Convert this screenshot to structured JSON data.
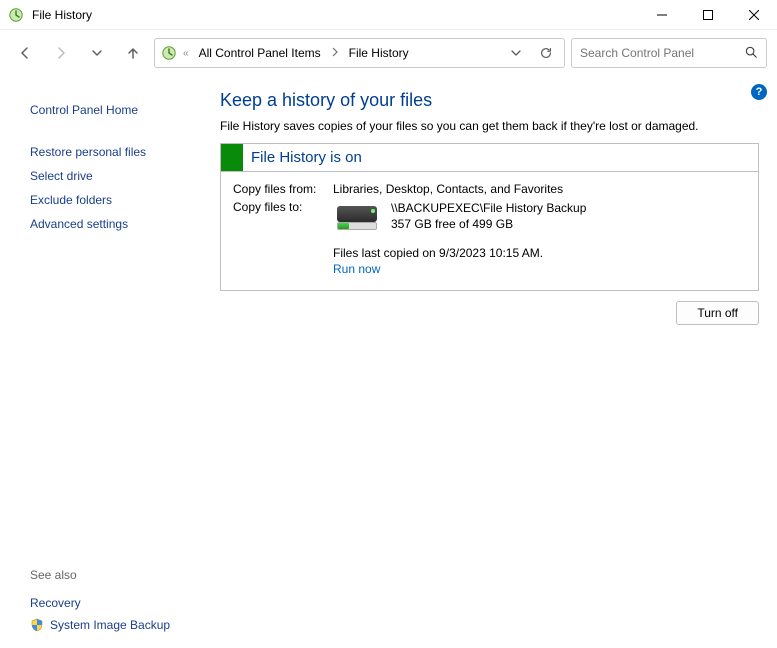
{
  "window": {
    "title": "File History"
  },
  "breadcrumb": {
    "truncated": "«",
    "item1": "All Control Panel Items",
    "item2": "File History"
  },
  "search": {
    "placeholder": "Search Control Panel"
  },
  "sidebar": {
    "home": "Control Panel Home",
    "links": {
      "restore": "Restore personal files",
      "select_drive": "Select drive",
      "exclude": "Exclude folders",
      "advanced": "Advanced settings"
    }
  },
  "seealso": {
    "label": "See also",
    "recovery": "Recovery",
    "system_image": "System Image Backup"
  },
  "main": {
    "heading": "Keep a history of your files",
    "subheading": "File History saves copies of your files so you can get them back if they're lost or damaged."
  },
  "panel": {
    "status_title": "File History is on",
    "copy_from_label": "Copy files from:",
    "copy_from_value": "Libraries, Desktop, Contacts, and Favorites",
    "copy_to_label": "Copy files to:",
    "dest_path": "\\\\BACKUPEXEC\\File History Backup",
    "dest_space": "357 GB free of 499 GB",
    "drive_used_pct": 28,
    "last_copied": "Files last copied on 9/3/2023 10:15 AM.",
    "run_now": "Run now"
  },
  "actions": {
    "turn_off": "Turn off"
  },
  "help": {
    "glyph": "?"
  }
}
